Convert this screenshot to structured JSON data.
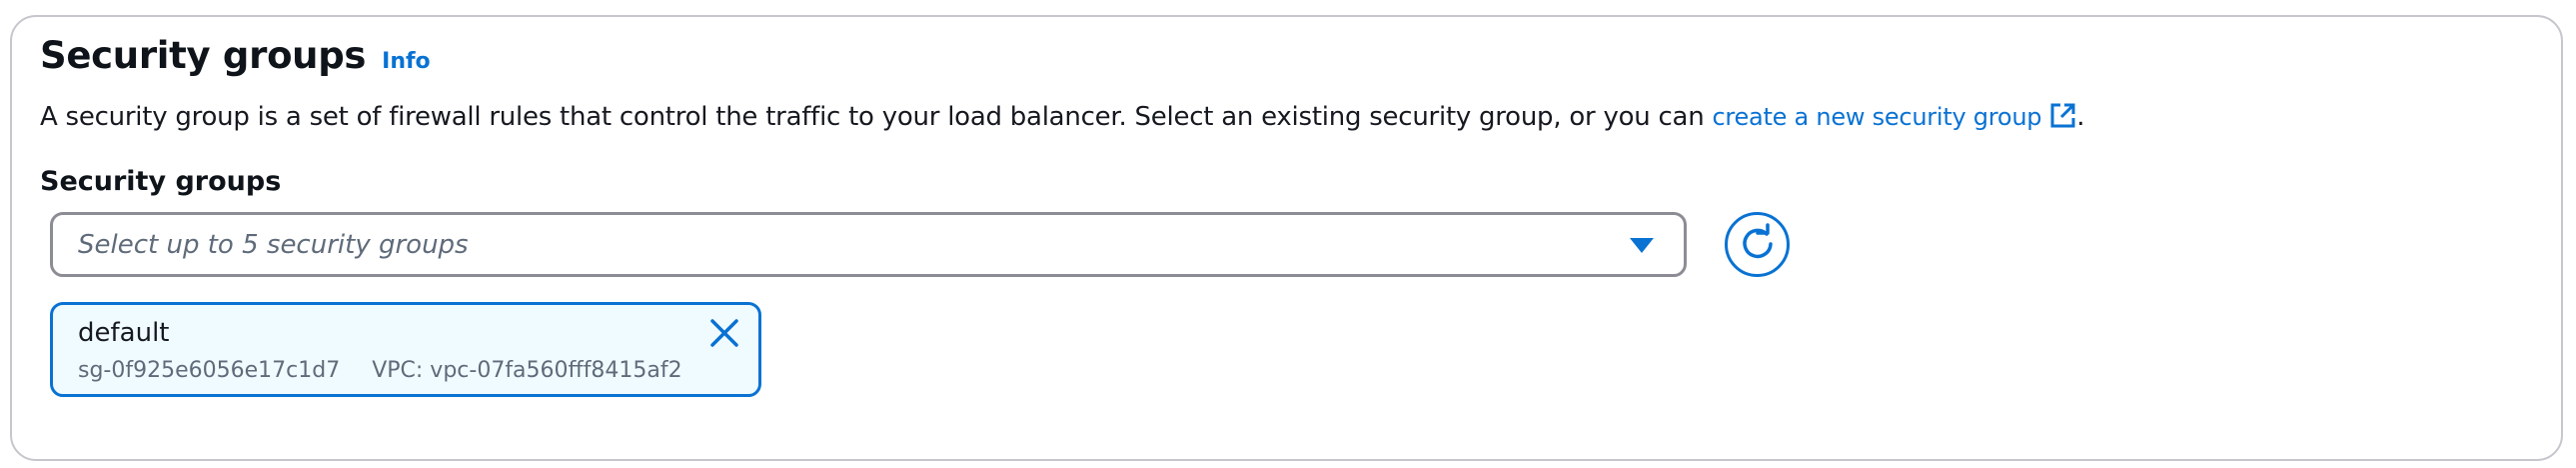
{
  "section": {
    "title": "Security groups",
    "info_label": "Info",
    "description_text": "A security group is a set of firewall rules that control the traffic to your load balancer. Select an existing security group, or you can ",
    "description_link": "create a new security group",
    "description_end": "."
  },
  "field": {
    "label": "Security groups",
    "placeholder": "Select up to 5 security groups"
  },
  "selected_groups": [
    {
      "name": "default",
      "id": "sg-0f925e6056e17c1d7",
      "vpc": "VPC: vpc-07fa560fff8415af2"
    }
  ],
  "icons": {
    "caret": "caret-down-icon",
    "refresh": "refresh-icon",
    "external": "external-link-icon",
    "dismiss": "close-icon"
  },
  "colors": {
    "link": "#0972d3",
    "token_background": "#f0fbff",
    "border": "#8c8c94"
  }
}
